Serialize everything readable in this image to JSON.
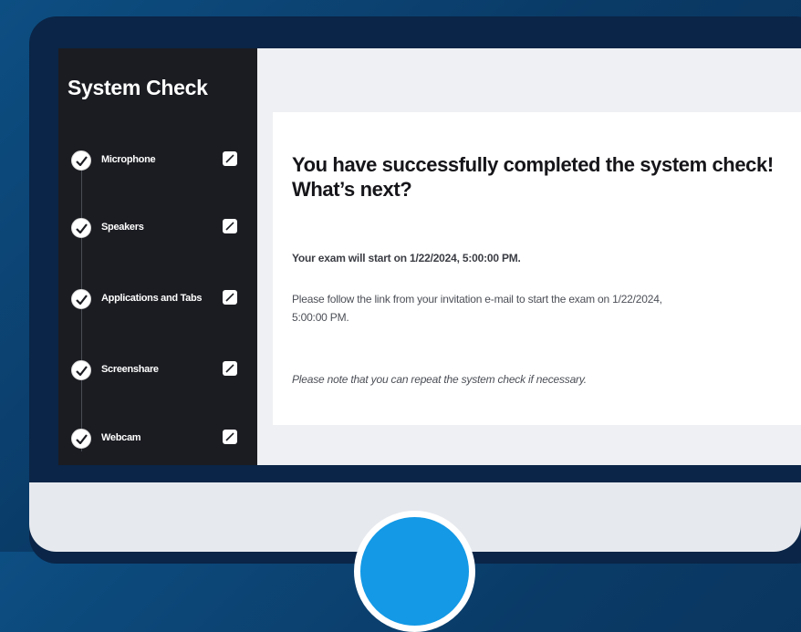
{
  "sidebar": {
    "title": "System Check",
    "steps": [
      {
        "label": "Microphone",
        "status": "completed"
      },
      {
        "label": "Speakers",
        "status": "completed"
      },
      {
        "label": "Applications and Tabs",
        "status": "completed"
      },
      {
        "label": "Screenshare",
        "status": "completed"
      },
      {
        "label": "Webcam",
        "status": "completed"
      }
    ]
  },
  "main": {
    "heading_line1": "You have successfully completed the system check!",
    "heading_line2": "What’s next?",
    "exam_start": "Your exam will start on 1/22/2024, 5:00:00 PM.",
    "follow_link": "Please follow the link from your invitation e-mail to start the exam on 1/22/2024, 5:00:00 PM.",
    "repeat_note": "Please note that you can repeat the system check if necessary."
  },
  "colors": {
    "background": "#0a3a66",
    "monitor_frame": "#0a2547",
    "sidebar": "#1b1c22",
    "accent": "#1399e6"
  },
  "icons": {
    "step": "check-circle-icon",
    "step_check": "checkbox-checked-icon"
  }
}
